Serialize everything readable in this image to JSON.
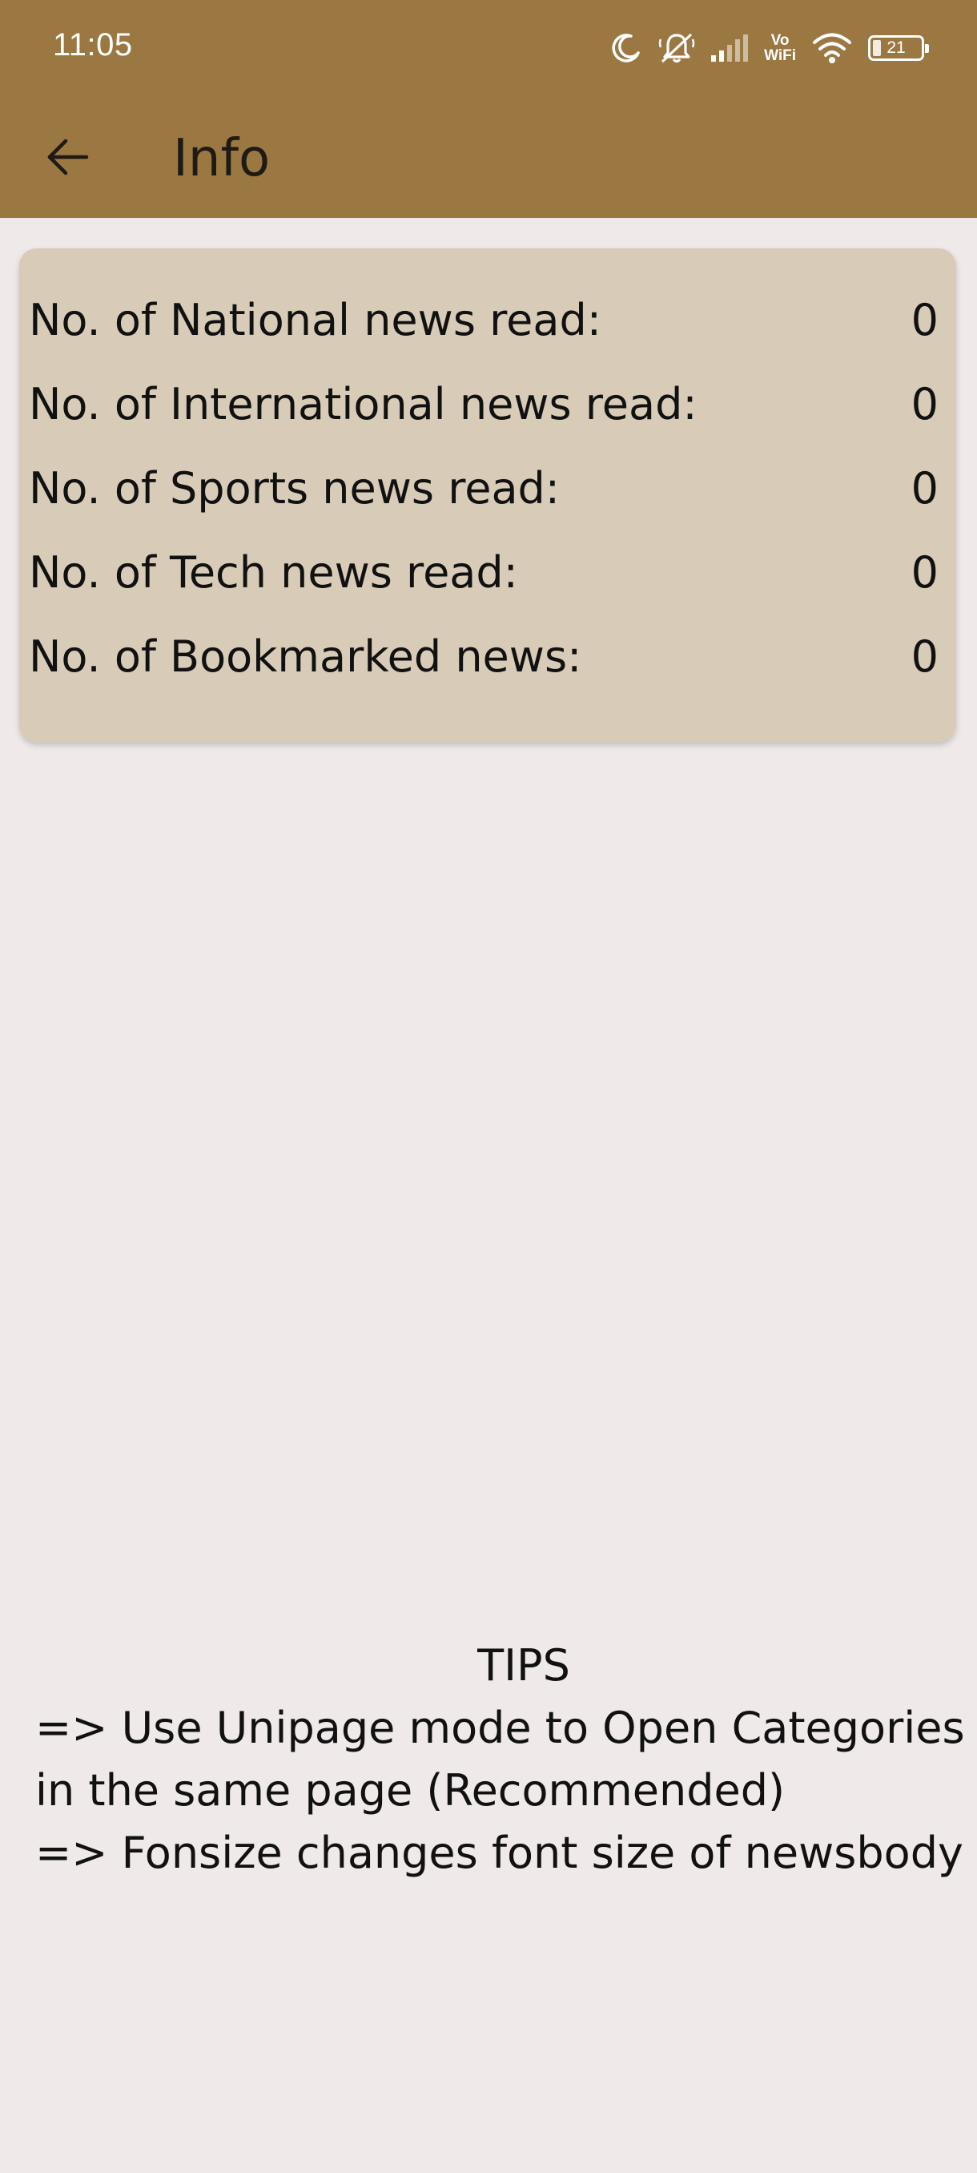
{
  "status_bar": {
    "time": "11:05",
    "icons": [
      "moon-icon",
      "bell-off-icon",
      "signal-icon",
      "vowifi-icon",
      "wifi-icon",
      "battery-icon"
    ],
    "vowifi_top": "Vo",
    "vowifi_bottom": "WiFi",
    "battery_level": "21"
  },
  "app_bar": {
    "back_icon": "arrow-left-icon",
    "title": "Info",
    "color": "#9b7842"
  },
  "stats": {
    "background": "#d8ccb8",
    "rows": [
      {
        "label": "No. of National news read:",
        "value": "0"
      },
      {
        "label": "No. of International news read:",
        "value": "0"
      },
      {
        "label": "No. of Sports news read:",
        "value": "0"
      },
      {
        "label": "No. of Tech news read:",
        "value": "0"
      },
      {
        "label": "No. of Bookmarked news:",
        "value": "0"
      }
    ]
  },
  "tips": {
    "title": "TIPS",
    "lines": [
      "=> Use Unipage mode to Open Categories",
      "in the same page (Recommended)",
      "=> Fonsize changes font size of newsbody"
    ]
  }
}
